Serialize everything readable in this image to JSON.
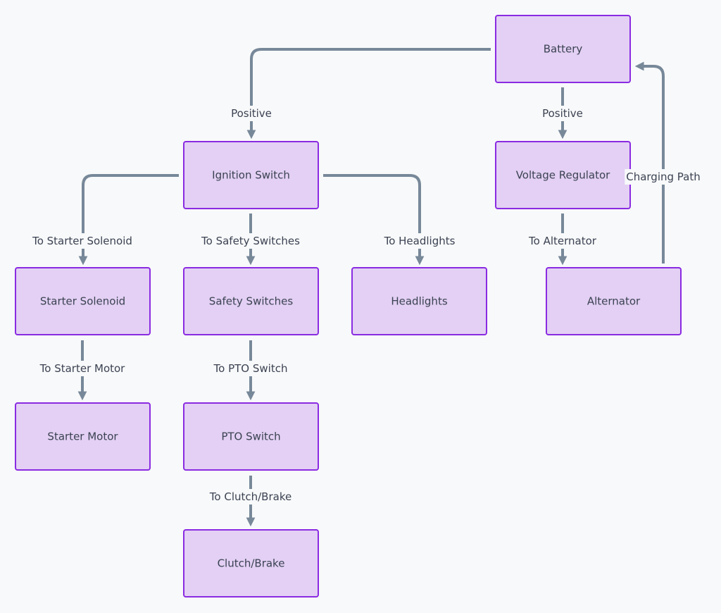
{
  "colors": {
    "background": "#f8f9fa",
    "node_fill": "#e3d0f4",
    "node_border": "#8a2be2",
    "edge": "#778899",
    "text": "#3b4252"
  },
  "nodes": [
    {
      "id": "battery",
      "label": "Battery"
    },
    {
      "id": "ignition",
      "label": "Ignition Switch"
    },
    {
      "id": "regulator",
      "label": "Voltage Regulator"
    },
    {
      "id": "solenoid",
      "label": "Starter Solenoid"
    },
    {
      "id": "safety",
      "label": "Safety Switches"
    },
    {
      "id": "headlights",
      "label": "Headlights"
    },
    {
      "id": "alternator",
      "label": "Alternator"
    },
    {
      "id": "motor",
      "label": "Starter Motor"
    },
    {
      "id": "pto",
      "label": "PTO Switch"
    },
    {
      "id": "clutch",
      "label": "Clutch/Brake"
    }
  ],
  "edges": [
    {
      "from": "battery",
      "to": "ignition",
      "label": "Positive"
    },
    {
      "from": "battery",
      "to": "regulator",
      "label": "Positive"
    },
    {
      "from": "ignition",
      "to": "solenoid",
      "label": "To Starter Solenoid"
    },
    {
      "from": "ignition",
      "to": "safety",
      "label": "To Safety Switches"
    },
    {
      "from": "ignition",
      "to": "headlights",
      "label": "To Headlights"
    },
    {
      "from": "regulator",
      "to": "alternator",
      "label": "To Alternator"
    },
    {
      "from": "alternator",
      "to": "battery",
      "label": "Charging Path"
    },
    {
      "from": "solenoid",
      "to": "motor",
      "label": "To Starter Motor"
    },
    {
      "from": "safety",
      "to": "pto",
      "label": "To PTO Switch"
    },
    {
      "from": "pto",
      "to": "clutch",
      "label": "To Clutch/Brake"
    }
  ]
}
